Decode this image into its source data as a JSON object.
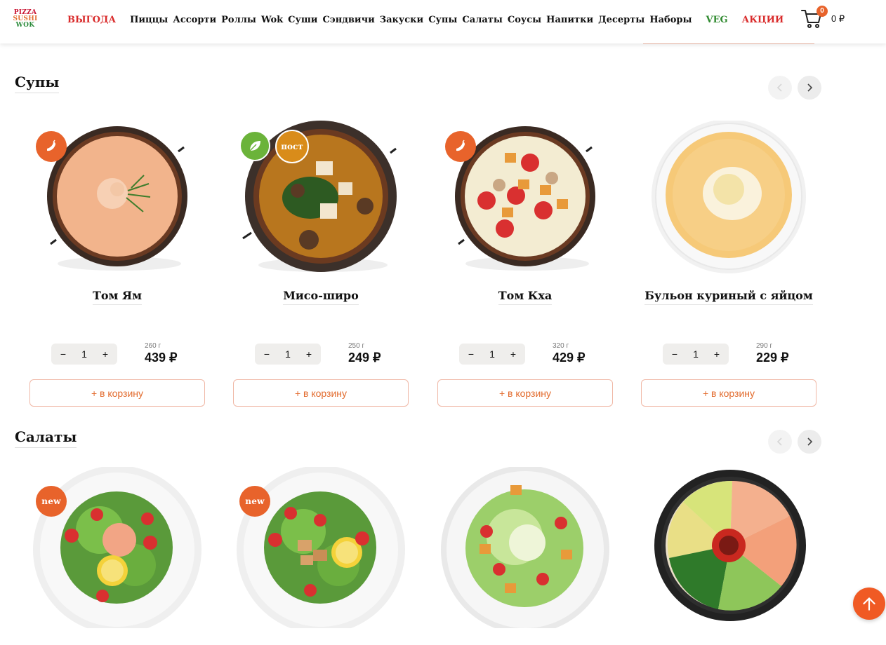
{
  "header": {
    "logo": [
      "PIZZA",
      "SUSHI",
      "WOK"
    ],
    "nav": [
      {
        "label": "ВЫГОДА",
        "style": "red"
      },
      {
        "label": "Пиццы",
        "style": "normal"
      },
      {
        "label": "Ассорти",
        "style": "normal"
      },
      {
        "label": "Роллы",
        "style": "normal"
      },
      {
        "label": "Wok",
        "style": "normal"
      },
      {
        "label": "Суши",
        "style": "normal"
      },
      {
        "label": "Сэндвичи",
        "style": "normal"
      },
      {
        "label": "Закуски",
        "style": "normal"
      },
      {
        "label": "Супы",
        "style": "normal"
      },
      {
        "label": "Салаты",
        "style": "normal"
      },
      {
        "label": "Соусы",
        "style": "normal"
      },
      {
        "label": "Напитки",
        "style": "normal"
      },
      {
        "label": "Десерты",
        "style": "normal"
      },
      {
        "label": "Наборы",
        "style": "normal"
      },
      {
        "label": "VEG",
        "style": "green"
      },
      {
        "label": "АКЦИИ",
        "style": "red"
      }
    ],
    "cart_count": "0",
    "cart_total": "0 ₽"
  },
  "soups": {
    "title": "Супы",
    "items": [
      {
        "name": "Том Ям",
        "qty": "1",
        "weight": "260 г",
        "price": "439 ₽",
        "add_label": "+ в корзину",
        "badges": [
          "chili-icon"
        ]
      },
      {
        "name": "Мисо-широ",
        "qty": "1",
        "weight": "250 г",
        "price": "249 ₽",
        "add_label": "+ в корзину",
        "badges": [
          "leaf-icon",
          "пост"
        ]
      },
      {
        "name": "Том Кха",
        "qty": "1",
        "weight": "320 г",
        "price": "429 ₽",
        "add_label": "+ в корзину",
        "badges": [
          "chili-icon"
        ]
      },
      {
        "name": "Бульон куриный с яйцом",
        "qty": "1",
        "weight": "290 г",
        "price": "229 ₽",
        "add_label": "+ в корзину",
        "badges": []
      }
    ]
  },
  "salads": {
    "title": "Салаты",
    "items": [
      {
        "badge": "new"
      },
      {
        "badge": "new"
      },
      {
        "badge": ""
      },
      {
        "badge": ""
      }
    ]
  },
  "colors": {
    "accent": "#e8632b",
    "nav_red": "#d92b2b",
    "nav_green": "#2f8a2f",
    "add_button_border": "#f0b8a6",
    "scroll_up": "#f05a24"
  }
}
